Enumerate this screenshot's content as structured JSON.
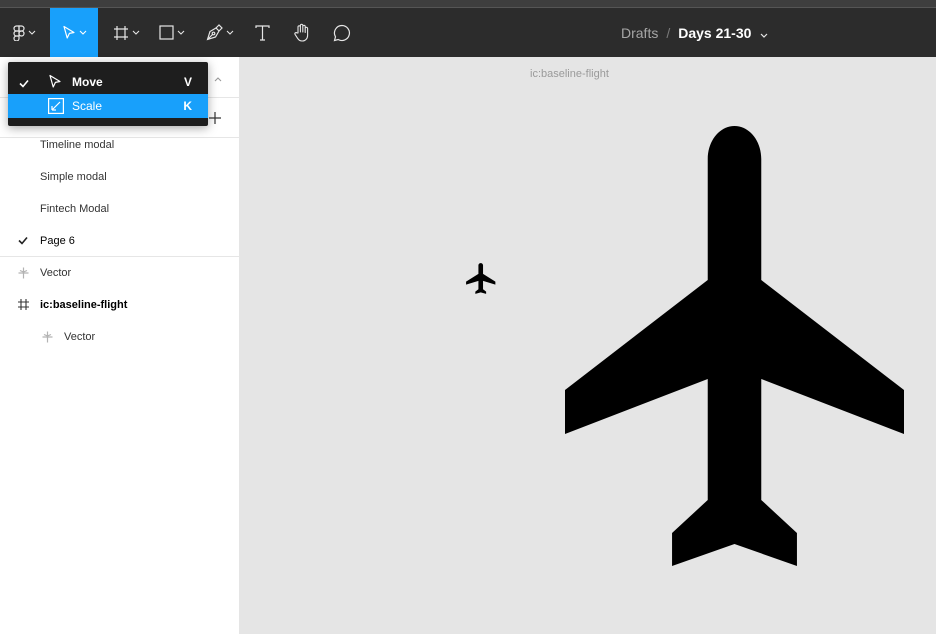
{
  "toolbar": {
    "tools": [
      {
        "icon": "figma-main-menu-icon"
      },
      {
        "icon": "move-tool-icon",
        "active": true
      },
      {
        "icon": "frame-tool-icon"
      },
      {
        "icon": "rectangle-tool-icon"
      },
      {
        "icon": "pen-tool-icon"
      },
      {
        "icon": "text-tool-icon"
      },
      {
        "icon": "hand-tool-icon"
      },
      {
        "icon": "comment-tool-icon"
      }
    ],
    "breadcrumb": {
      "parent": "Drafts",
      "separator": "/",
      "current": "Days 21-30"
    }
  },
  "dropdown": {
    "items": [
      {
        "label": "Move",
        "shortcut": "V",
        "checked": true,
        "icon": "move-arrow-icon"
      },
      {
        "label": "Scale",
        "shortcut": "K",
        "checked": false,
        "highlighted": true,
        "icon": "scale-icon"
      }
    ]
  },
  "pages": [
    {
      "label": "Timeline modal"
    },
    {
      "label": "Simple modal"
    },
    {
      "label": "Fintech Modal"
    },
    {
      "label": "Page 6",
      "current": true
    }
  ],
  "layers": [
    {
      "label": "Vector",
      "icon": "vector-icon"
    },
    {
      "label": "ic:baseline-flight",
      "icon": "frame-icon"
    },
    {
      "label": "Vector",
      "icon": "vector-icon"
    }
  ],
  "canvas": {
    "frame_label": "ic:baseline-flight"
  },
  "colors": {
    "accent": "#18a0fb",
    "toolbar_bg": "#2c2c2c",
    "canvas_bg": "#e5e5e5",
    "menu_bg": "#1e1e1e"
  }
}
